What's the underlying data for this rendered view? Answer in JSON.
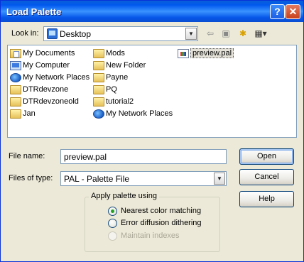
{
  "window": {
    "title": "Load Palette",
    "help_glyph": "?",
    "close_glyph": "✕"
  },
  "lookin": {
    "label": "Look in:",
    "hotkey": "i",
    "value": "Desktop"
  },
  "toolbar": [
    {
      "name": "back-icon",
      "glyph": "⇦"
    },
    {
      "name": "up-folder-icon",
      "glyph": "▣"
    },
    {
      "name": "new-folder-icon",
      "glyph": "✱"
    },
    {
      "name": "view-menu-icon",
      "glyph": "▦▾"
    }
  ],
  "files": [
    {
      "label": "My Documents",
      "icon": "mydocs"
    },
    {
      "label": "My Computer",
      "icon": "computer"
    },
    {
      "label": "My Network Places",
      "icon": "network"
    },
    {
      "label": "DTRdevzone",
      "icon": "folder"
    },
    {
      "label": "DTRdevzoneold",
      "icon": "folder"
    },
    {
      "label": "Jan",
      "icon": "folder"
    },
    {
      "label": "Mods",
      "icon": "folder"
    },
    {
      "label": "New Folder",
      "icon": "folder"
    },
    {
      "label": "Payne",
      "icon": "folder"
    },
    {
      "label": "PQ",
      "icon": "folder"
    },
    {
      "label": "tutorial2",
      "icon": "folder"
    },
    {
      "label": "My Network Places",
      "icon": "network"
    },
    {
      "label": "preview.pal",
      "icon": "palfile",
      "selected": true
    }
  ],
  "filename": {
    "label": "File name:",
    "value": "preview.pal"
  },
  "filetype": {
    "label": "Files of type:",
    "value": "PAL - Palette File"
  },
  "buttons": {
    "open": "Open",
    "cancel": "Cancel",
    "help": "Help"
  },
  "apply": {
    "title": "Apply palette using",
    "options": [
      {
        "label": "Nearest color matching",
        "checked": true,
        "disabled": false
      },
      {
        "label": "Error diffusion dithering",
        "checked": false,
        "disabled": false
      },
      {
        "label": "Maintain indexes",
        "checked": false,
        "disabled": true
      }
    ]
  },
  "colors": {
    "titlebar": "#0058ee",
    "dialog": "#ece9d8",
    "selected_radio": "#21a121"
  }
}
